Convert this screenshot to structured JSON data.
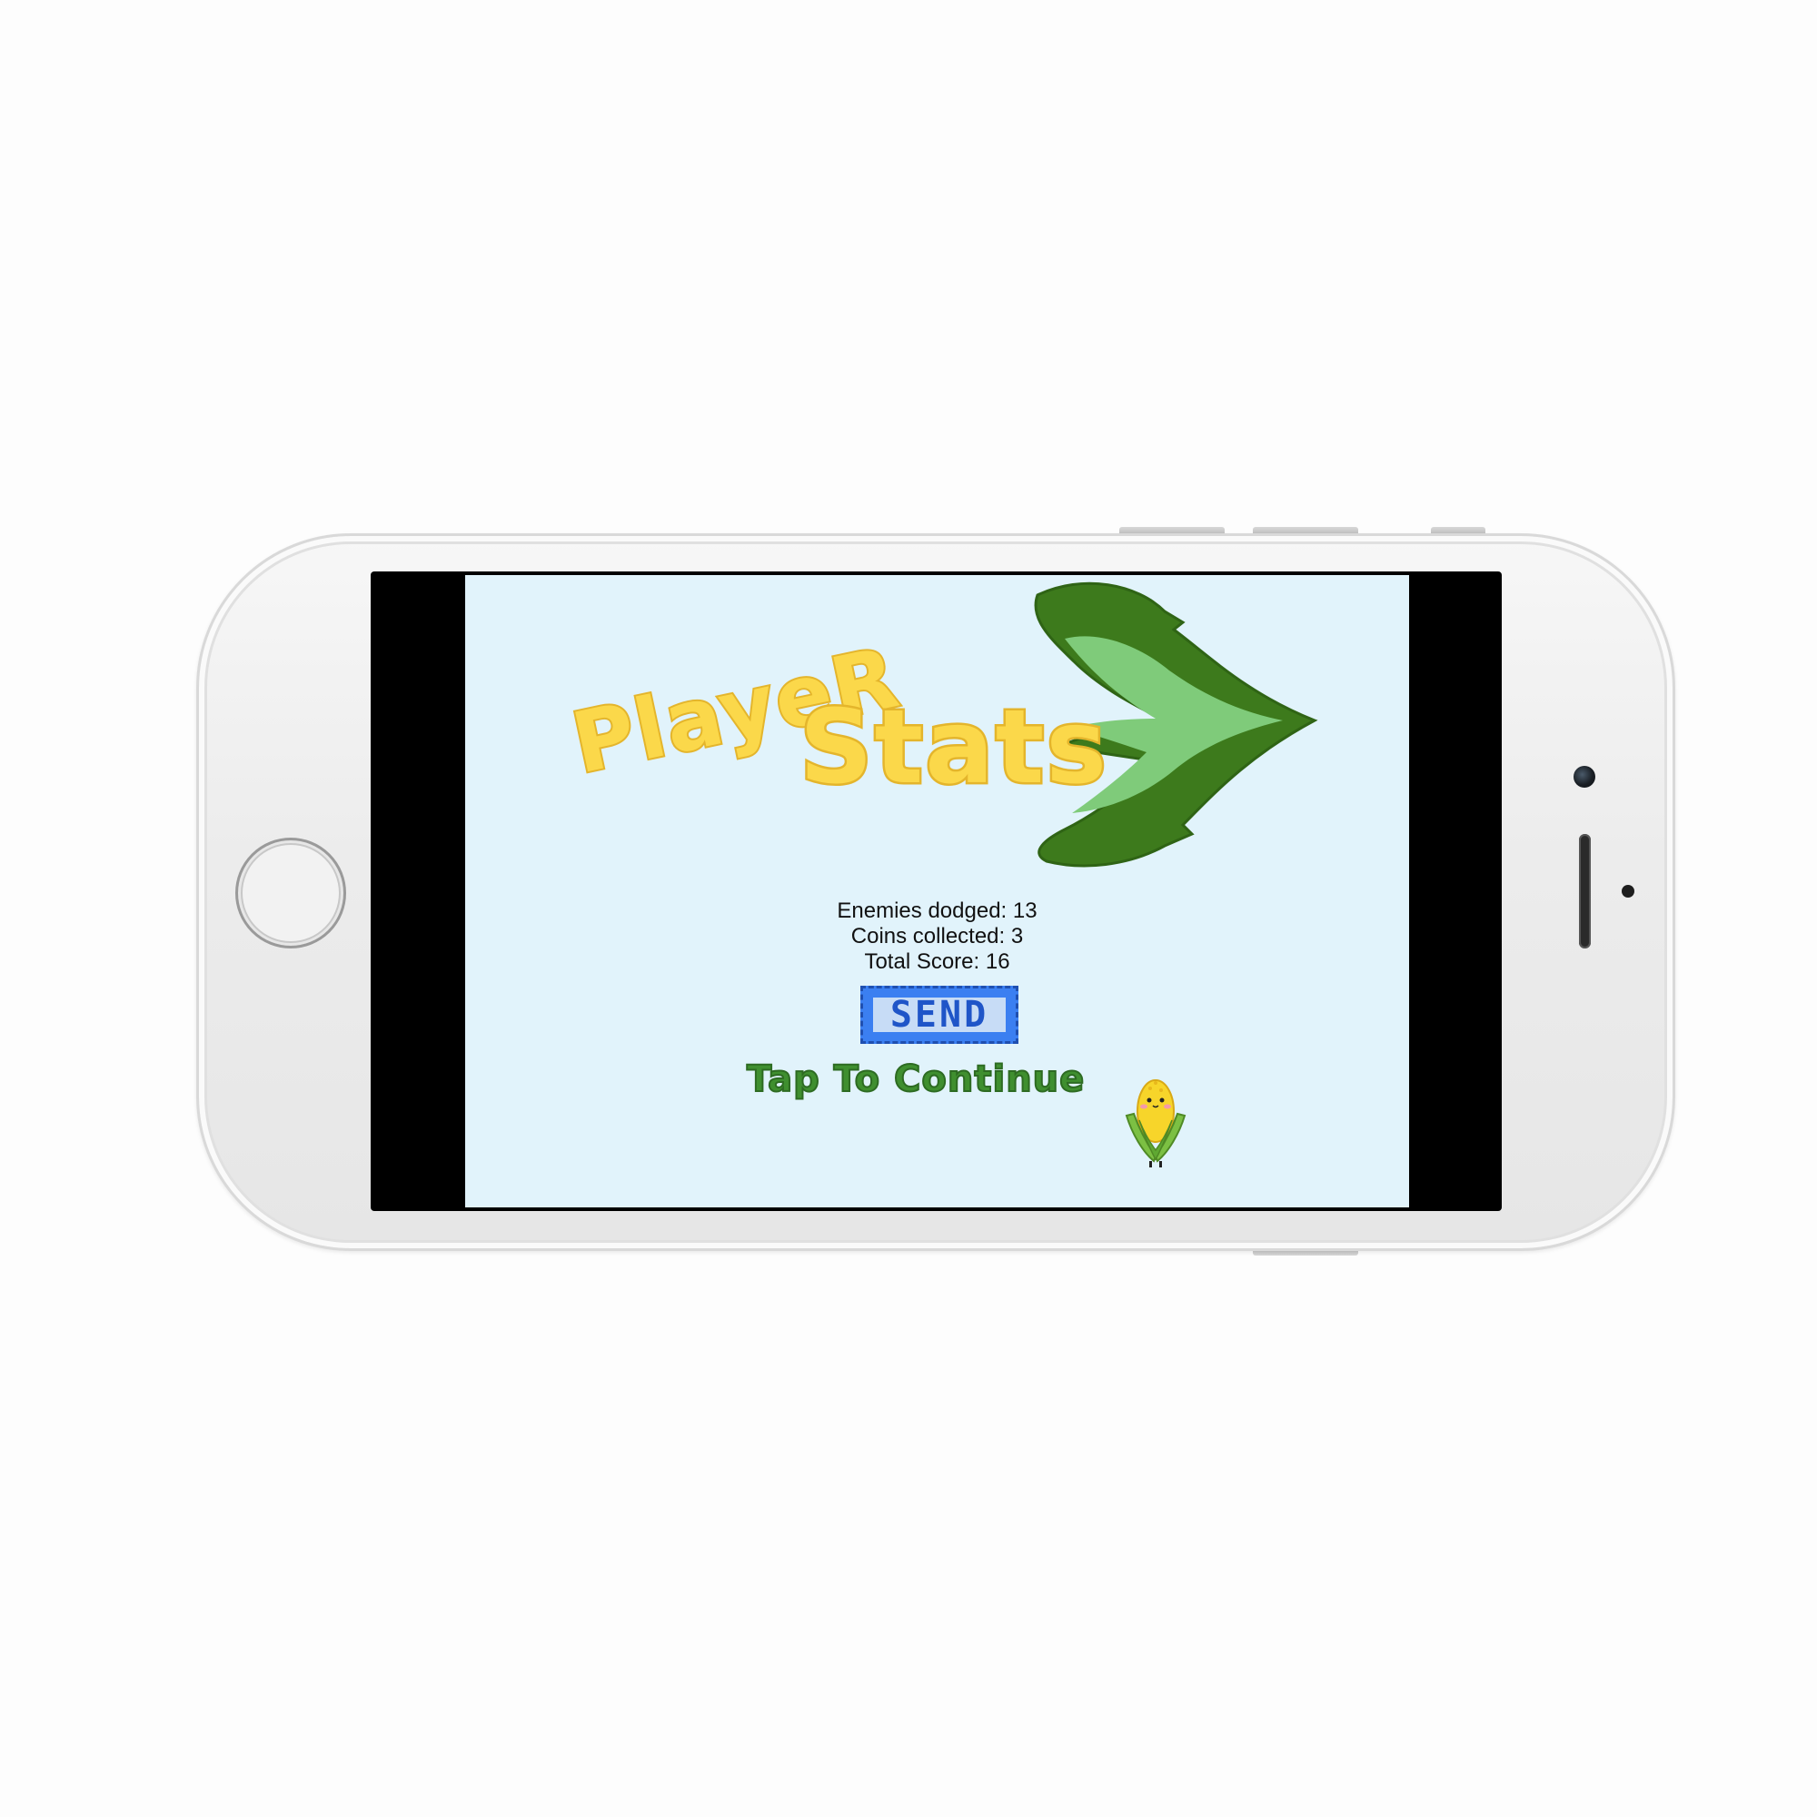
{
  "device": {
    "model_icon": "iphone-landscape-frame"
  },
  "game": {
    "title_line1": "PlayeR",
    "title_line2": "Stats",
    "stats": {
      "enemies_dodged": "Enemies dodged: 13",
      "coins_collected": "Coins collected: 3",
      "total_score": "Total Score: 16"
    },
    "send_label": "SEND",
    "tap_label": "Tap To Continue",
    "colors": {
      "background": "#e1f3fb",
      "title_fill": "#fbd84a",
      "title_shadow": "#e4b52c",
      "leaf_dark": "#3d7a1c",
      "leaf_light": "#7fcb7a",
      "send_blue": "#3b7ff1",
      "tap_green": "#3f8f2f"
    },
    "icons": [
      "corn-leaf-arrow-icon",
      "corn-mascot-icon"
    ]
  }
}
